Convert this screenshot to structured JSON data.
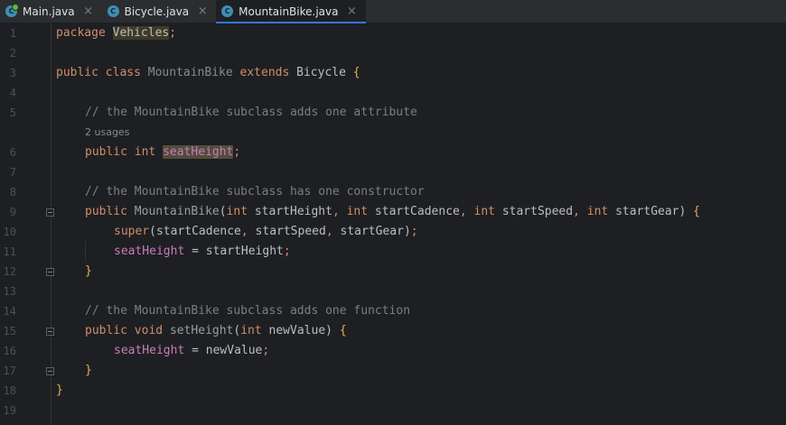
{
  "tabs": [
    {
      "label": "Main.java",
      "icon": "java-main-icon",
      "active": false
    },
    {
      "label": "Bicycle.java",
      "icon": "java-class-icon",
      "active": false
    },
    {
      "label": "MountainBike.java",
      "icon": "java-class-icon",
      "active": true
    }
  ],
  "colors": {
    "background": "#1e1f22",
    "tab_bar": "#2b2d30",
    "keyword": "#cf8e6d",
    "comment": "#7a7e85",
    "field": "#c77dbb",
    "accent": "#3574f0"
  },
  "editor": {
    "line_numbers": [
      "1",
      "2",
      "3",
      "4",
      "5",
      "6",
      "7",
      "8",
      "9",
      "10",
      "11",
      "12",
      "13",
      "14",
      "15",
      "16",
      "17",
      "18",
      "19"
    ],
    "usage_hint": "2 usages",
    "tokens": {
      "l1_kw": "package",
      "l1_pkg": "Vehicles",
      "l1_semi": ";",
      "l3_kw1": "public",
      "l3_kw2": "class",
      "l3_name": "MountainBike",
      "l3_kw3": "extends",
      "l3_super": "Bicycle",
      "l3_brace": "{",
      "l5_comment": "// the MountainBike subclass adds one attribute",
      "l6_kw1": "public",
      "l6_kw2": "int",
      "l6_field": "seatHeight",
      "l6_semi": ";",
      "l8_comment": "// the MountainBike subclass has one constructor",
      "l9_kw": "public",
      "l9_name": "MountainBike",
      "l9_open": "(",
      "l9_t1": "int",
      "l9_p1": "startHeight",
      "l9_c1": ",",
      "l9_t2": "int",
      "l9_p2": "startCadence",
      "l9_c2": ",",
      "l9_t3": "int",
      "l9_p3": "startSpeed",
      "l9_c3": ",",
      "l9_t4": "int",
      "l9_p4": "startGear",
      "l9_close": ")",
      "l9_brace": "{",
      "l10_super": "super",
      "l10_args": "(startCadence",
      "l10_c1": ",",
      "l10_a2": "startSpeed",
      "l10_c2": ",",
      "l10_a3": "startGear",
      "l10_end": ")",
      "l10_semi": ";",
      "l11_field": "seatHeight",
      "l11_eq": "= startHeight",
      "l11_semi": ";",
      "l12_brace": "}",
      "l14_comment": "// the MountainBike subclass adds one function",
      "l15_kw1": "public",
      "l15_kw2": "void",
      "l15_name": "setHeight",
      "l15_open": "(",
      "l15_t1": "int",
      "l15_p1": "newValue",
      "l15_close": ")",
      "l15_brace": "{",
      "l16_field": "seatHeight",
      "l16_eq": "= newValue",
      "l16_semi": ";",
      "l17_brace": "}",
      "l18_brace": "}"
    }
  }
}
